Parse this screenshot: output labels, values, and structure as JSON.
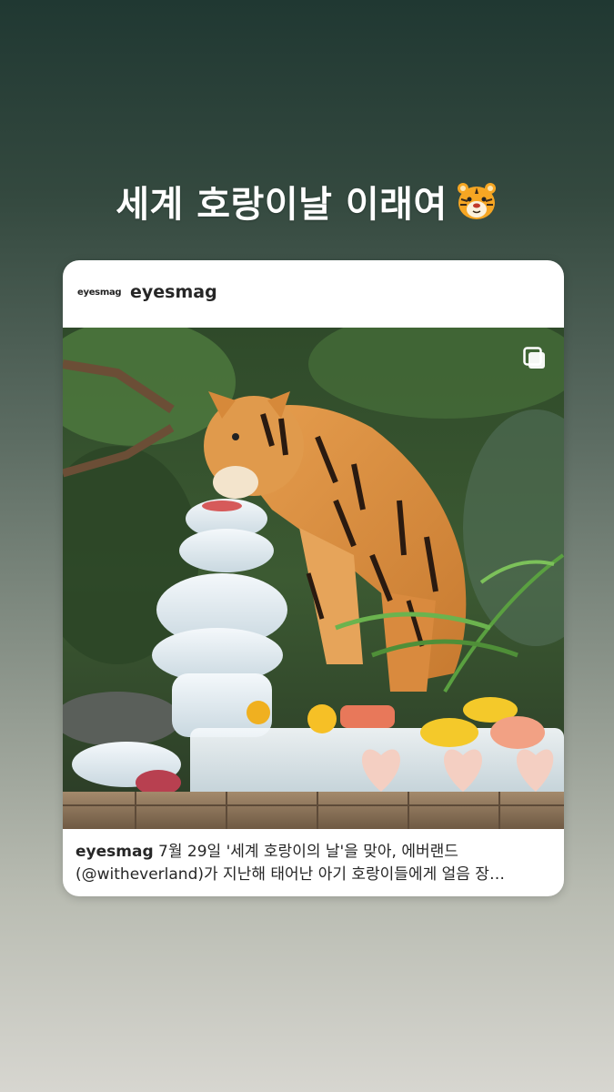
{
  "story": {
    "caption": "세계 호랑이날 이래여",
    "caption_emoji": "tiger-face-emoji"
  },
  "post": {
    "logo_text": "eyesmag",
    "username": "eyesmag",
    "carousel_icon": "multiple-images-icon",
    "photo_description_icon": "tiger-eating-ice-cake-photo",
    "caption_user": "eyesmag",
    "caption_line1": " 7월 29일 '세계 호랑이의 날'을 맞아, 에버랜드",
    "caption_line2": "(@witheverland)가 지난해 태어난 아기 호랑이들에게 얼음 장…"
  },
  "colors": {
    "card_bg": "#ffffff",
    "text_primary": "#262626",
    "bg_top": "#203832",
    "bg_bottom": "#d7d6d0"
  }
}
